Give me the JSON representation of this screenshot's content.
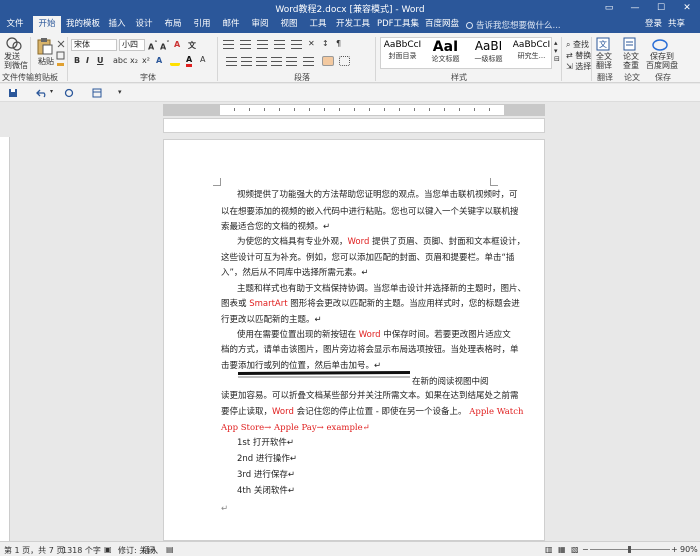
{
  "window": {
    "title": "Word教程2.docx [兼容模式] - Word",
    "minimize": "—",
    "maximize": "☐",
    "close": "✕"
  },
  "tabs": [
    {
      "label": "文件"
    },
    {
      "label": "开始"
    },
    {
      "label": "我的模板"
    },
    {
      "label": "插入"
    },
    {
      "label": "设计"
    },
    {
      "label": "布局"
    },
    {
      "label": "引用"
    },
    {
      "label": "邮件"
    },
    {
      "label": "审阅"
    },
    {
      "label": "视图"
    },
    {
      "label": "工具"
    },
    {
      "label": "开发工具"
    },
    {
      "label": "PDF工具集"
    },
    {
      "label": "百度网盘"
    }
  ],
  "tell_me": "告诉我您想要做什么...",
  "account": {
    "login": "登录",
    "share": "共享"
  },
  "ribbon": {
    "send": {
      "label": "发送\n到微信"
    },
    "paste": {
      "label": "粘贴"
    },
    "font_name": "宋体",
    "font_size": "小四",
    "styles": [
      {
        "sample": "AaBbCcI",
        "name": "封面目录"
      },
      {
        "sample": "AaI",
        "name": "论文标题"
      },
      {
        "sample": "AaBI",
        "name": "一级标题"
      },
      {
        "sample": "AaBbCcI",
        "name": "研究生..."
      }
    ],
    "edit": {
      "find": "查找",
      "replace": "替换",
      "select": "选择"
    },
    "fulltext": "全文\n翻译",
    "check": "论文\n查重",
    "save_baidu": "保存到\n百度网盘",
    "groups": {
      "file_transfer": "文件传输",
      "clipboard": "剪贴板",
      "font": "字体",
      "paragraph": "段落",
      "styles": "样式",
      "translate": "翻译",
      "paper": "论文",
      "save": "保存"
    }
  },
  "document": {
    "paragraphs": [
      {
        "text": "视频提供了功能强大的方法帮助您证明您的观点。当您单击联机视频时，可"
      },
      {
        "text": "以在想要添加的视频的嵌入代码中进行粘贴。您也可以键入一个关键字以联机搜"
      },
      {
        "text": "索最适合您的文档的视频。↵"
      },
      {
        "pre": "为使您的文档具有专业外观，",
        "red": "Word",
        "post": " 提供了页眉、页脚、封面和文本框设计，"
      },
      {
        "text": "这些设计可互为补充。例如，您可以添加匹配的封面、页眉和提要栏。单击“插"
      },
      {
        "text": "入”，然后从不同库中选择所需元素。↵"
      },
      {
        "text": "主题和样式也有助于文档保持协调。当您单击设计并选择新的主题时，图片、"
      },
      {
        "pre": "图表或 ",
        "red": "SmartArt",
        "post": " 图形将会更改以匹配新的主题。当应用样式时，您的标题会进"
      },
      {
        "text": "行更改以匹配新的主题。↵"
      },
      {
        "pre": "使用在需要位置出现的新按钮在 ",
        "red": "Word",
        "post": " 中保存时间。若要更改图片适应文"
      },
      {
        "text": "档的方式，请单击该图片，图片旁边将会显示布局选项按钮。当处理表格时，单"
      },
      {
        "text": "击要添加行或列的位置，然后单击加号。↵"
      },
      {
        "text": "在新的阅读视图中阅"
      },
      {
        "text": "读更加容易。可以折叠文档某些部分并关注所需文本。如果在达到结尾处之前需"
      },
      {
        "pre": "要停止读取，",
        "red": "Word",
        "post": " 会记住您的停止位置 - 即使在另一个设备上。"
      }
    ],
    "apple_tail": "Apple Watch",
    "red_line": "App Store→ Apple Pay→ example↵",
    "list": [
      "1st 打开软件↵",
      "2nd 进行操作↵",
      "3rd 进行保存↵",
      "4th 关闭软件↵"
    ],
    "empty_mark": "↵"
  },
  "status": {
    "page": "第 1 页，共 7 页",
    "words": "1318 个字",
    "track": "修订: 关闭",
    "mode": "插入",
    "zoom": "90%"
  }
}
